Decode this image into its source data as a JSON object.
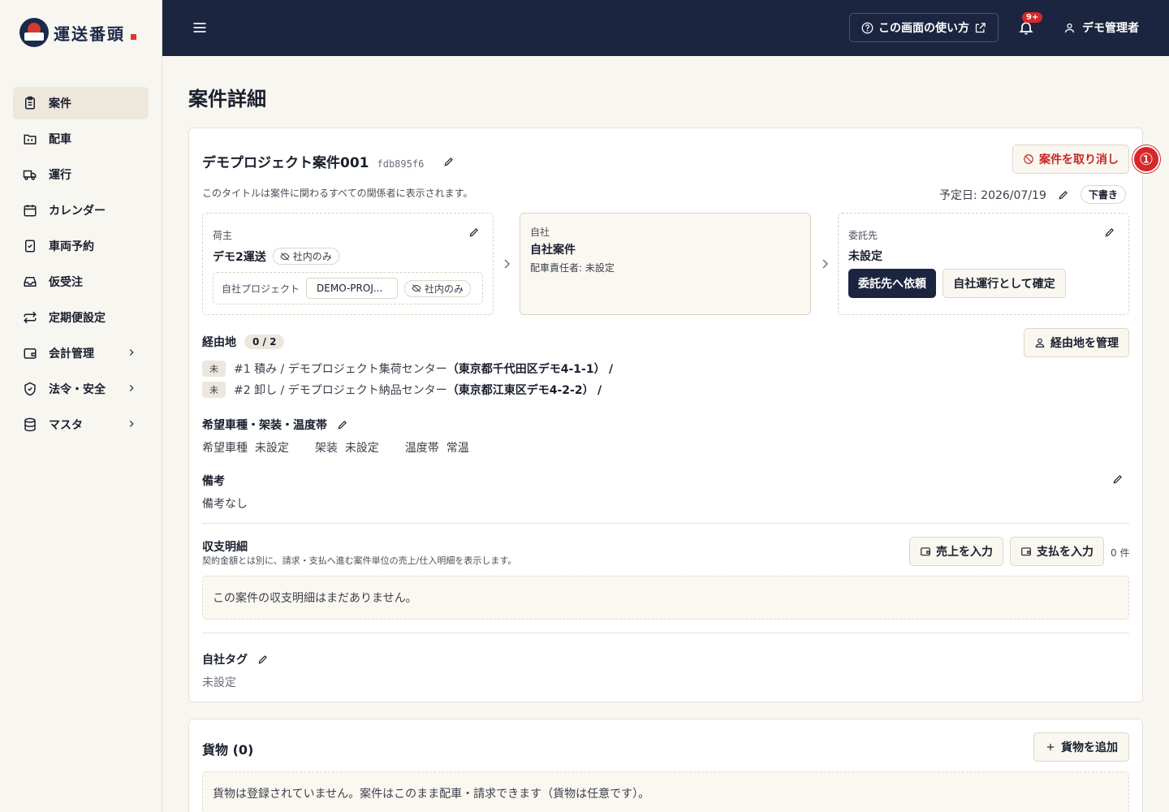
{
  "app": {
    "logo_text": "運送番頭"
  },
  "sidebar": {
    "items": [
      {
        "label": "案件",
        "icon": "clipboard-icon",
        "active": true
      },
      {
        "label": "配車",
        "icon": "folder-icon"
      },
      {
        "label": "運行",
        "icon": "truck-icon"
      },
      {
        "label": "カレンダー",
        "icon": "calendar-icon"
      },
      {
        "label": "車両予約",
        "icon": "clipboard-check-icon"
      },
      {
        "label": "仮受注",
        "icon": "inbox-icon"
      },
      {
        "label": "定期便設定",
        "icon": "repeat-icon"
      },
      {
        "label": "会計管理",
        "icon": "wallet-icon",
        "expandable": true
      },
      {
        "label": "法令・安全",
        "icon": "shield-icon",
        "expandable": true
      },
      {
        "label": "マスタ",
        "icon": "database-icon",
        "expandable": true
      }
    ]
  },
  "header": {
    "help_label": "この画面の使い方",
    "notification_badge": "9+",
    "user_name": "デモ管理者"
  },
  "page": {
    "title": "案件詳細"
  },
  "project": {
    "title": "デモプロジェクト案件001",
    "hash": "fdb895f6",
    "subtitle": "このタイトルは案件に関わるすべての関係者に表示されます。",
    "cancel_label": "案件を取り消し",
    "step_marker": "①",
    "date_label": "予定日: 2026/07/19",
    "status": "下書き"
  },
  "parties": {
    "shipper": {
      "label": "荷主",
      "name": "デモ2運送",
      "visibility": "社内のみ",
      "project_label": "自社プロジェクト",
      "project_value": "DEMO-PROJ...",
      "project_visibility": "社内のみ"
    },
    "self": {
      "label": "自社",
      "name": "自社案件",
      "manager": "配車責任者: 未設定"
    },
    "contractor": {
      "label": "委託先",
      "name": "未設定",
      "request_label": "委託先へ依頼",
      "confirm_label": "自社運行として確定"
    }
  },
  "waypoints": {
    "title": "経由地",
    "count": "0 / 2",
    "manage_label": "経由地を管理",
    "items": [
      {
        "status": "未",
        "text": "#1 積み / デモプロジェクト集荷センター",
        "address": "（東京都千代田区デモ4-1-1）",
        "tail": "/"
      },
      {
        "status": "未",
        "text": "#2 卸し / デモプロジェクト納品センター",
        "address": "（東京都江東区デモ4-2-2）",
        "tail": "/"
      }
    ]
  },
  "vehicle": {
    "title": "希望車種・架装・温度帯",
    "type_label": "希望車種",
    "type_value": "未設定",
    "body_label": "架装",
    "body_value": "未設定",
    "temp_label": "温度帯",
    "temp_value": "常温"
  },
  "notes": {
    "title": "備考",
    "value": "備考なし"
  },
  "finance": {
    "title": "収支明細",
    "description": "契約金額とは別に、請求・支払へ進む案件単位の売上/仕入明細を表示します。",
    "sales_label": "売上を入力",
    "payment_label": "支払を入力",
    "count": "0 件",
    "empty": "この案件の収支明細はまだありません。"
  },
  "tags": {
    "title": "自社タグ",
    "value": "未設定"
  },
  "cargo": {
    "title": "貨物 (0)",
    "add_label": "貨物を追加",
    "empty": "貨物は登録されていません。案件はこのまま配車・請求できます（貨物は任意です）。"
  }
}
